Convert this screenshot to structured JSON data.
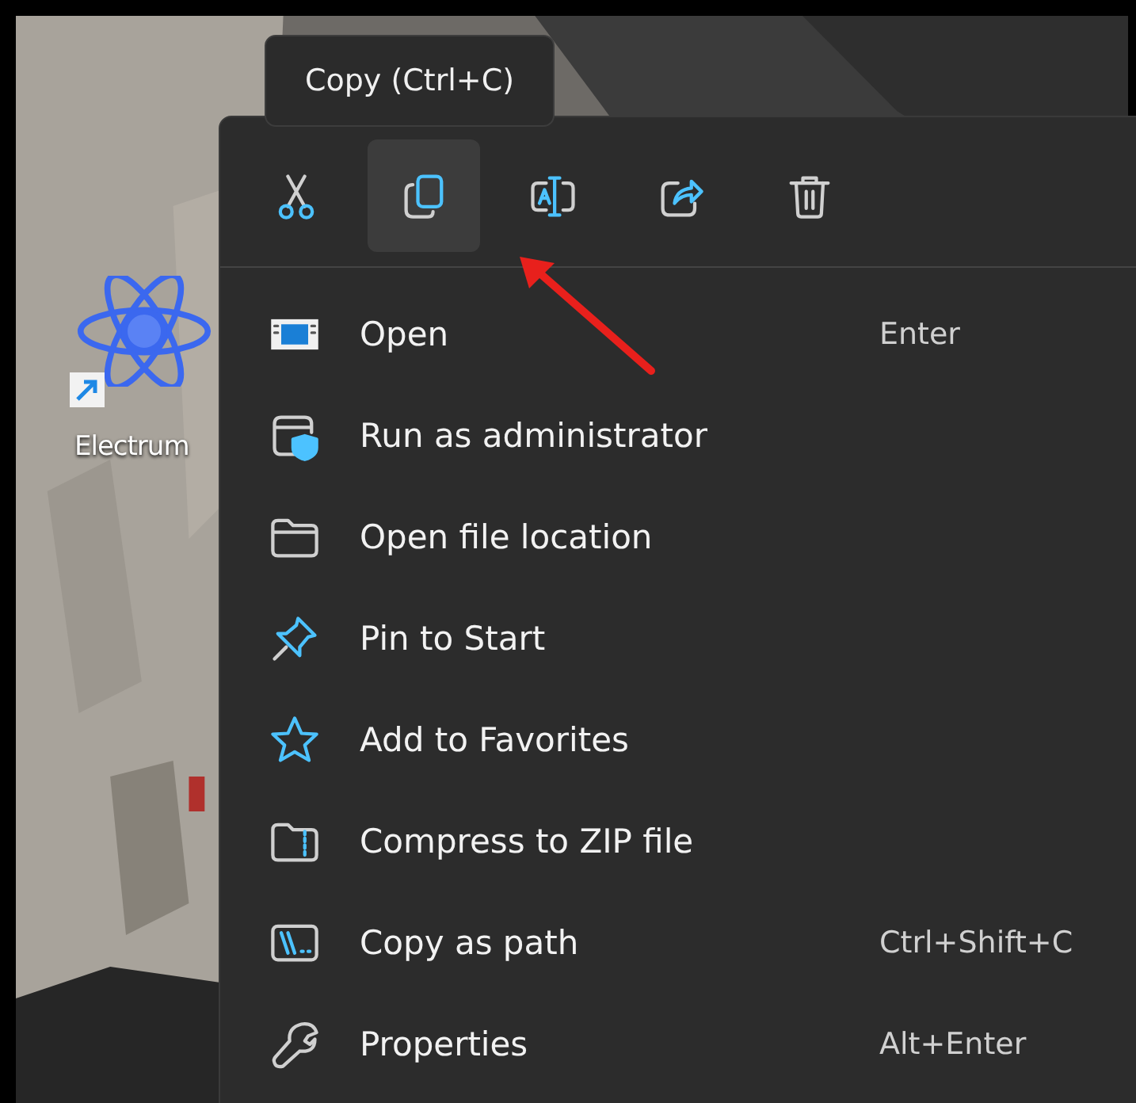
{
  "desktop": {
    "icons": [
      {
        "label": "Electrum",
        "shortcut": true
      }
    ]
  },
  "tooltip": {
    "text": "Copy (Ctrl+C)"
  },
  "context_menu": {
    "toolbar": [
      {
        "kind": "cut",
        "selected": false
      },
      {
        "kind": "copy",
        "selected": true
      },
      {
        "kind": "rename",
        "selected": false
      },
      {
        "kind": "share",
        "selected": false
      },
      {
        "kind": "delete",
        "selected": false
      }
    ],
    "items": [
      {
        "kind": "open",
        "label": "Open",
        "shortcut": "Enter"
      },
      {
        "kind": "admin",
        "label": "Run as administrator"
      },
      {
        "kind": "folder",
        "label": "Open file location"
      },
      {
        "kind": "pin",
        "label": "Pin to Start"
      },
      {
        "kind": "star",
        "label": "Add to Favorites"
      },
      {
        "kind": "zip",
        "label": "Compress to ZIP file"
      },
      {
        "kind": "path",
        "label": "Copy as path",
        "shortcut": "Ctrl+Shift+C"
      },
      {
        "kind": "wrench",
        "label": "Properties",
        "shortcut": "Alt+Enter"
      }
    ]
  },
  "annotation": {
    "kind": "arrow"
  }
}
